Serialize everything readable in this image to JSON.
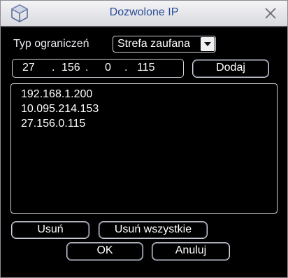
{
  "dialog": {
    "title": "Dozwolone IP",
    "icons": {
      "logo": "cube-logo-icon",
      "close": "close-icon",
      "dropdown": "caret-down-icon"
    }
  },
  "restriction": {
    "label": "Typ ograniczeń",
    "selected": "Strefa zaufana"
  },
  "ip_input": {
    "octets": [
      "27",
      "156",
      "0",
      "115"
    ],
    "separator": "."
  },
  "buttons": {
    "add": "Dodaj",
    "remove": "Usuń",
    "remove_all": "Usuń wszystkie",
    "ok": "OK",
    "cancel": "Anuluj"
  },
  "ip_list": [
    "192.168.1.200",
    "10.095.214.153",
    "27.156.0.115"
  ],
  "colors": {
    "title_text": "#2a4a9a",
    "background": "#000000",
    "border": "#cfd2da"
  }
}
